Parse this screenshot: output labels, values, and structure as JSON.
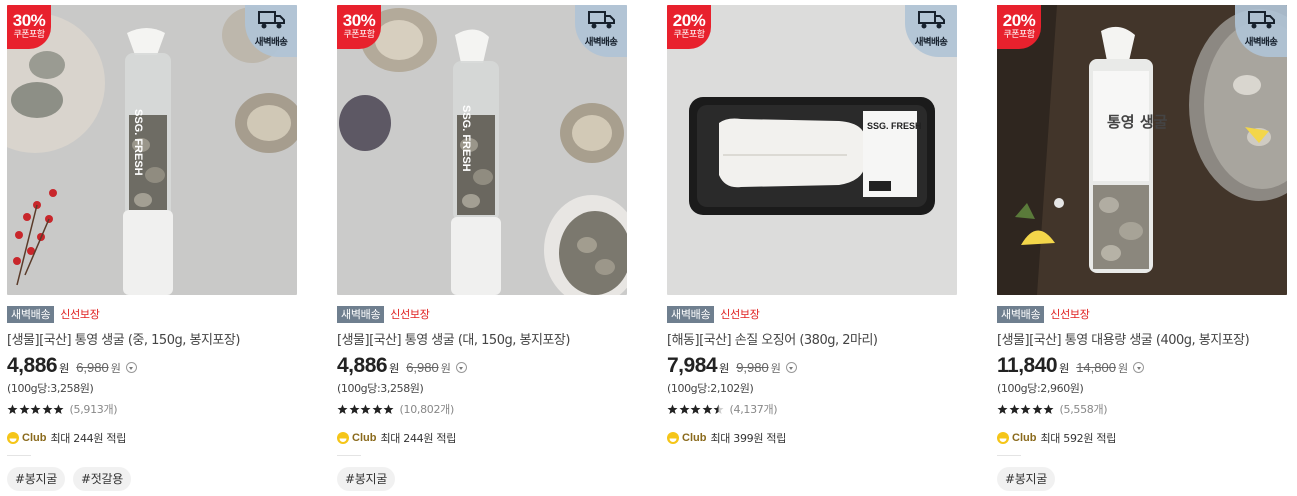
{
  "products": [
    {
      "discount": "30%",
      "coupon": "쿠폰포함",
      "dawn_label": "새벽배송",
      "badge_dawn": "새벽배송",
      "badge_fresh": "신선보장",
      "title": "[생물][국산] 통영 생굴 (중, 150g, 봉지포장)",
      "price": "4,886",
      "won": "원",
      "original_price": "6,980",
      "unit_price": "(100g당:3,258원)",
      "rating": 5,
      "review_count": "(5,913개)",
      "club_name": "Club",
      "club_text": "최대 244원 적립",
      "tags": [
        "#봉지굴",
        "#젓갈용"
      ],
      "package_text": "SSG. FRESH"
    },
    {
      "discount": "30%",
      "coupon": "쿠폰포함",
      "dawn_label": "새벽배송",
      "badge_dawn": "새벽배송",
      "badge_fresh": "신선보장",
      "title": "[생물][국산] 통영 생굴 (대, 150g, 봉지포장)",
      "price": "4,886",
      "won": "원",
      "original_price": "6,980",
      "unit_price": "(100g당:3,258원)",
      "rating": 5,
      "review_count": "(10,802개)",
      "club_name": "Club",
      "club_text": "최대 244원 적립",
      "tags": [
        "#봉지굴"
      ],
      "package_text": "SSG. FRESH"
    },
    {
      "discount": "20%",
      "coupon": "쿠폰포함",
      "dawn_label": "새벽배송",
      "badge_dawn": "새벽배송",
      "badge_fresh": "신선보장",
      "title": "[해동][국산] 손질 오징어 (380g, 2마리)",
      "price": "7,984",
      "won": "원",
      "original_price": "9,980",
      "unit_price": "(100g당:2,102원)",
      "rating": 4.5,
      "review_count": "(4,137개)",
      "club_name": "Club",
      "club_text": "최대 399원 적립",
      "tags": [],
      "package_text": "SSG. FRESH"
    },
    {
      "discount": "20%",
      "coupon": "쿠폰포함",
      "dawn_label": "새벽배송",
      "badge_dawn": "새벽배송",
      "badge_fresh": "신선보장",
      "title": "[생물][국산] 통영 대용량 생굴 (400g, 봉지포장)",
      "price": "11,840",
      "won": "원",
      "original_price": "14,800",
      "unit_price": "(100g당:2,960원)",
      "rating": 5,
      "review_count": "(5,558개)",
      "club_name": "Club",
      "club_text": "최대 592원 적립",
      "tags": [
        "#봉지굴"
      ],
      "package_text": "통영 생굴"
    }
  ],
  "colors": {
    "discount_red": "#e8212d",
    "dawn_badge_bg": "#6f7f8f",
    "fresh_red": "#e02020",
    "star": "#222222",
    "club_gold": "#f5c518"
  },
  "icons": {
    "dawn": "delivery-truck-icon",
    "info": "chevron-down-circle-icon",
    "star": "star-icon",
    "club": "club-coin-icon"
  }
}
